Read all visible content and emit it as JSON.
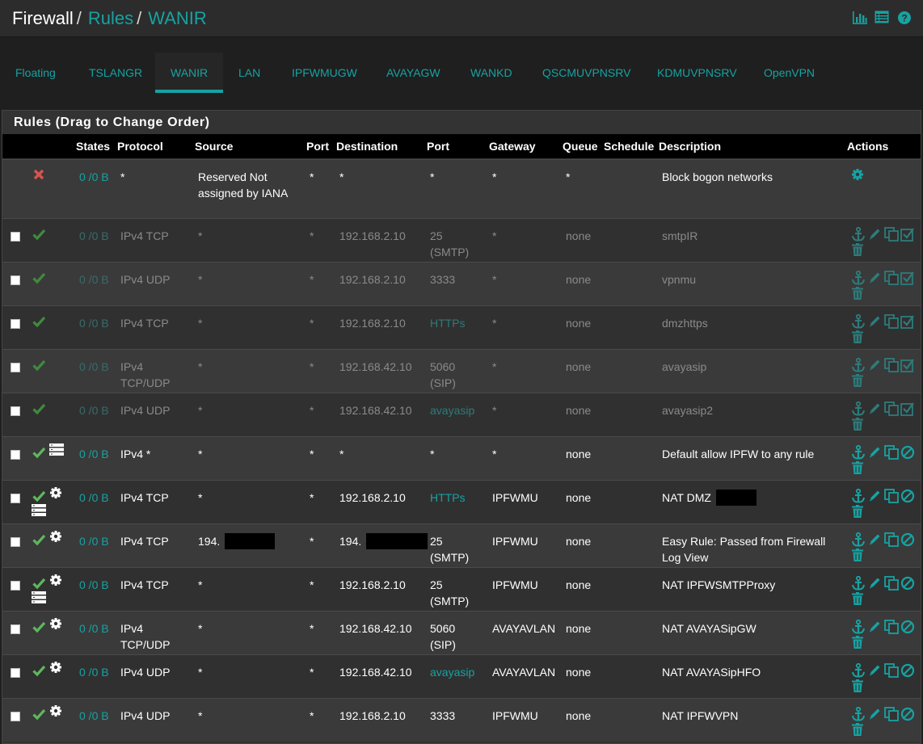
{
  "breadcrumb": {
    "root": "Firewall",
    "section": "Rules",
    "page": "WANIR"
  },
  "header_icons": [
    "chart-icon",
    "table-icon",
    "help-icon"
  ],
  "tabs": [
    {
      "label": "Floating",
      "active": false
    },
    {
      "label": "TSLANGR",
      "active": false
    },
    {
      "label": "WANIR",
      "active": true
    },
    {
      "label": "LAN",
      "active": false
    },
    {
      "label": "IPFWMUGW",
      "active": false
    },
    {
      "label": "AVAYAGW",
      "active": false
    },
    {
      "label": "WANKD",
      "active": false
    },
    {
      "label": "QSCMUVPNSRV",
      "active": false
    },
    {
      "label": "KDMUVPNSRV",
      "active": false
    },
    {
      "label": "OpenVPN",
      "active": false
    }
  ],
  "panel_title": "Rules (Drag to Change Order)",
  "columns": {
    "states": "States",
    "protocol": "Protocol",
    "source": "Source",
    "sport": "Port",
    "destination": "Destination",
    "dport": "Port",
    "gateway": "Gateway",
    "queue": "Queue",
    "schedule": "Schedule",
    "description": "Description",
    "actions": "Actions"
  },
  "rows": [
    {
      "status": "block",
      "states": "0 /0 B",
      "protocol": "*",
      "source": "Reserved Not assigned by IANA",
      "sport": "*",
      "destination": "*",
      "dport": "*",
      "gateway": "*",
      "queue": "*",
      "description": "Block bogon networks",
      "disabled": false
    },
    {
      "status": "pass",
      "states": "0 /0 B",
      "protocol": "IPv4 TCP",
      "source": "*",
      "sport": "*",
      "destination": "192.168.2.10",
      "dport": "25 (SMTP)",
      "gateway": "*",
      "queue": "none",
      "description": "smtpIR",
      "disabled": true
    },
    {
      "status": "pass",
      "states": "0 /0 B",
      "protocol": "IPv4 UDP",
      "source": "*",
      "sport": "*",
      "destination": "192.168.2.10",
      "dport": "3333",
      "gateway": "*",
      "queue": "none",
      "description": "vpnmu",
      "disabled": true
    },
    {
      "status": "pass",
      "states": "0 /0 B",
      "protocol": "IPv4 TCP",
      "source": "*",
      "sport": "*",
      "destination": "192.168.2.10",
      "dport": "HTTPs",
      "gateway": "*",
      "queue": "none",
      "description": "dmzhttps",
      "disabled": true
    },
    {
      "status": "pass",
      "states": "0 /0 B",
      "protocol": "IPv4 TCP/UDP",
      "source": "*",
      "sport": "*",
      "destination": "192.168.42.10",
      "dport": "5060 (SIP)",
      "gateway": "*",
      "queue": "none",
      "description": "avayasip",
      "disabled": true
    },
    {
      "status": "pass",
      "states": "0 /0 B",
      "protocol": "IPv4 UDP",
      "source": "*",
      "sport": "*",
      "destination": "192.168.42.10",
      "dport": "avayasip",
      "gateway": "*",
      "queue": "none",
      "description": "avayasip2",
      "disabled": true
    },
    {
      "status": "pass",
      "states": "0 /0 B",
      "protocol": "IPv4 *",
      "source": "*",
      "sport": "*",
      "destination": "*",
      "dport": "*",
      "gateway": "*",
      "queue": "none",
      "description": "Default allow IPFW to any rule",
      "disabled": false
    },
    {
      "status": "pass",
      "states": "0 /0 B",
      "protocol": "IPv4 TCP",
      "source": "*",
      "sport": "*",
      "destination": "192.168.2.10",
      "dport": "HTTPs",
      "gateway": "IPFWMU",
      "queue": "none",
      "description": "NAT DMZ",
      "disabled": false
    },
    {
      "status": "pass",
      "states": "0 /0 B",
      "protocol": "IPv4 TCP",
      "source": "194.",
      "sport": "*",
      "destination": "194.",
      "dport": "25 (SMTP)",
      "gateway": "IPFWMU",
      "queue": "none",
      "description": "Easy Rule: Passed from Firewall Log View",
      "disabled": false
    },
    {
      "status": "pass",
      "states": "0 /0 B",
      "protocol": "IPv4 TCP",
      "source": "*",
      "sport": "*",
      "destination": "192.168.2.10",
      "dport": "25 (SMTP)",
      "gateway": "IPFWMU",
      "queue": "none",
      "description": "NAT IPFWSMTPProxy",
      "disabled": false
    },
    {
      "status": "pass",
      "states": "0 /0 B",
      "protocol": "IPv4 TCP/UDP",
      "source": "*",
      "sport": "*",
      "destination": "192.168.42.10",
      "dport": "5060 (SIP)",
      "gateway": "AVAYAVLAN",
      "queue": "none",
      "description": "NAT AVAYASipGW",
      "disabled": false
    },
    {
      "status": "pass",
      "states": "0 /0 B",
      "protocol": "IPv4 UDP",
      "source": "*",
      "sport": "*",
      "destination": "192.168.42.10",
      "dport": "avayasip",
      "gateway": "AVAYAVLAN",
      "queue": "none",
      "description": "NAT AVAYASipHFO",
      "disabled": false
    },
    {
      "status": "pass",
      "states": "0 /0 B",
      "protocol": "IPv4 UDP",
      "source": "*",
      "sport": "*",
      "destination": "192.168.2.10",
      "dport": "3333",
      "gateway": "IPFWMU",
      "queue": "none",
      "description": "NAT IPFWVPN",
      "disabled": false
    }
  ],
  "colors": {
    "accent": "#17a2a2",
    "pass": "#5cb85c",
    "block": "#d9534f",
    "header_bg": "#000000"
  }
}
